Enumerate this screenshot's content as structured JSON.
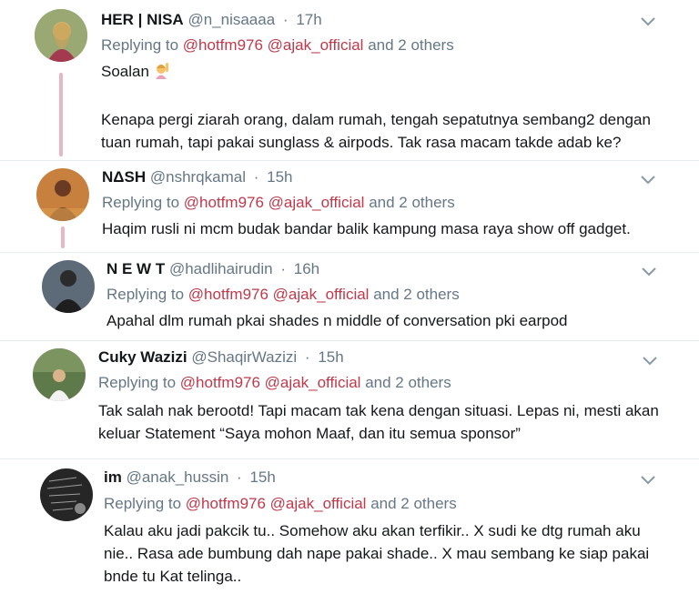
{
  "tweets": [
    {
      "name": "HER | NISA",
      "handle": "@n_nisaaaa",
      "time": "17h",
      "replying_label": "Replying to",
      "mentions": [
        "@hotfm976",
        "@ajak_official"
      ],
      "others": "and 2 others",
      "lines": [
        "Soalan",
        "",
        "Kenapa pergi ziarah orang, dalam rumah, tengah sepatutnya sembang2 dengan",
        "tuan rumah, tapi pakai sunglass & airpods. Tak rasa macam takde adab ke?"
      ],
      "emoji": "woman-raising-hand-emoji"
    },
    {
      "name": "NΔSH",
      "handle": "@nshrqkamal",
      "time": "15h",
      "replying_label": "Replying to",
      "mentions": [
        "@hotfm976",
        "@ajak_official"
      ],
      "others": "and 2 others",
      "lines": [
        "Haqim rusli ni mcm budak bandar balik kampung masa raya show off gadget."
      ]
    },
    {
      "name": "N E W T",
      "handle": "@hadlihairudin",
      "time": "16h",
      "replying_label": "Replying to",
      "mentions": [
        "@hotfm976",
        "@ajak_official"
      ],
      "others": "and 2 others",
      "lines": [
        "Apahal dlm rumah pkai shades n middle of conversation pki earpod"
      ]
    },
    {
      "name": "Cuky Wazizi",
      "handle": "@ShaqirWazizi",
      "time": "15h",
      "replying_label": "Replying to",
      "mentions": [
        "@hotfm976",
        "@ajak_official"
      ],
      "others": "and 2 others",
      "lines": [
        "Tak salah nak berootd! Tapi macam tak kena dengan situasi. Lepas ni, mesti akan",
        "keluar Statement “Saya mohon Maaf, dan itu semua sponsor”"
      ]
    },
    {
      "name": "im",
      "handle": "@anak_hussin",
      "time": "15h",
      "replying_label": "Replying to",
      "mentions": [
        "@hotfm976",
        "@ajak_official"
      ],
      "others": "and 2 others",
      "lines": [
        "Kalau aku jadi pakcik tu.. Somehow aku akan terfikir.. X sudi ke dtg rumah aku",
        "nie.. Rasa ade bumbung dah nape pakai shade.. X mau sembang ke siap pakai",
        "bnde tu Kat telinga.."
      ]
    }
  ],
  "colors": {
    "mention": "#c0394b",
    "muted": "#657786",
    "thread": "#e9b7c4"
  }
}
